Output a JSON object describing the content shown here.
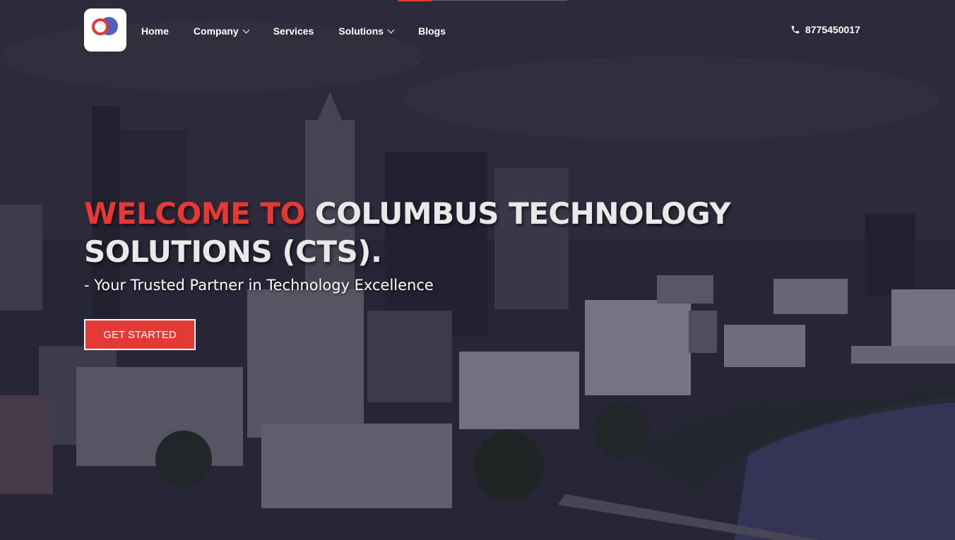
{
  "colors": {
    "accent": "#e53935",
    "text": "#ffffff"
  },
  "nav": {
    "items": [
      {
        "label": "Home",
        "dropdown": false
      },
      {
        "label": "Company",
        "dropdown": true
      },
      {
        "label": "Services",
        "dropdown": false
      },
      {
        "label": "Solutions",
        "dropdown": true
      },
      {
        "label": "Blogs",
        "dropdown": false
      }
    ]
  },
  "header": {
    "phone": "8775450017",
    "phone_icon": "phone-icon",
    "logo_icon": "cts-logo"
  },
  "hero": {
    "title_accent": "WELCOME TO",
    "title_line1_rest": "COLUMBUS TECHNOLOGY",
    "title_line2": "SOLUTIONS (CTS).",
    "subtitle": "- Your Trusted Partner in Technology Excellence",
    "cta_label": "GET STARTED"
  }
}
